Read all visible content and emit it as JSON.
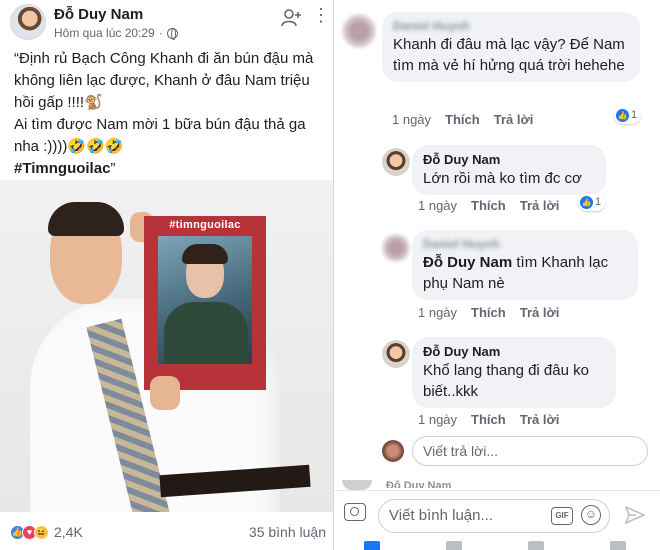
{
  "post": {
    "author": "Đỗ Duy Nam",
    "timestamp": "Hôm qua lúc 20:29",
    "privacy_icon": "globe-icon",
    "text_line_1": "“Định rủ Bạch Công Khanh đi ăn bún đậu mà không liên lạc được, Khanh ở đâu Nam triệu hồi gấp !!!!🐒",
    "text_line_2": "Ai tìm được Nam mời 1 bữa bún đậu thả ga nha :))))🤣🤣🤣",
    "hashtag": "#Timnguoilac",
    "closing_quote": "”",
    "photo_frame_text": "#timnguoilac",
    "reaction_icons": [
      "like-icon",
      "love-icon",
      "haha-icon"
    ],
    "reaction_count": "2,4K",
    "comment_count": "35 bình luận"
  },
  "comments": [
    {
      "author": "Daniel Huynh",
      "text": "Khanh đi đâu mà lạc vậy? Để Nam tìm mà vẻ hí hửng quá trời hehehe",
      "time": "1 ngày",
      "like_label": "Thích",
      "reply_label": "Trả lời",
      "likes": "1"
    },
    {
      "author": "Đỗ Duy Nam",
      "text": "Lớn rồi mà ko tìm đc cơ",
      "time": "1 ngày",
      "like_label": "Thích",
      "reply_label": "Trả lời",
      "likes": "1"
    },
    {
      "author": "Daniel Huynh",
      "tag": "Đỗ Duy Nam",
      "text": " tìm Khanh lạc phụ Nam nè",
      "time": "1 ngày",
      "like_label": "Thích",
      "reply_label": "Trả lời"
    },
    {
      "author": "Đỗ Duy Nam",
      "text": "Khổ lang thang đi đâu ko biết..kkk",
      "time": "1 ngày",
      "like_label": "Thích",
      "reply_label": "Trả lời"
    }
  ],
  "reply_input": {
    "placeholder": "Viết trả lời..."
  },
  "next_comment_author": "Đỗ Duy Nam",
  "composer": {
    "placeholder": "Viết bình luận...",
    "gif_label": "GIF"
  },
  "colors": {
    "link_blue": "#1877f2",
    "bubble_gray": "#f0f2f5",
    "frame_red": "#b7333a"
  }
}
